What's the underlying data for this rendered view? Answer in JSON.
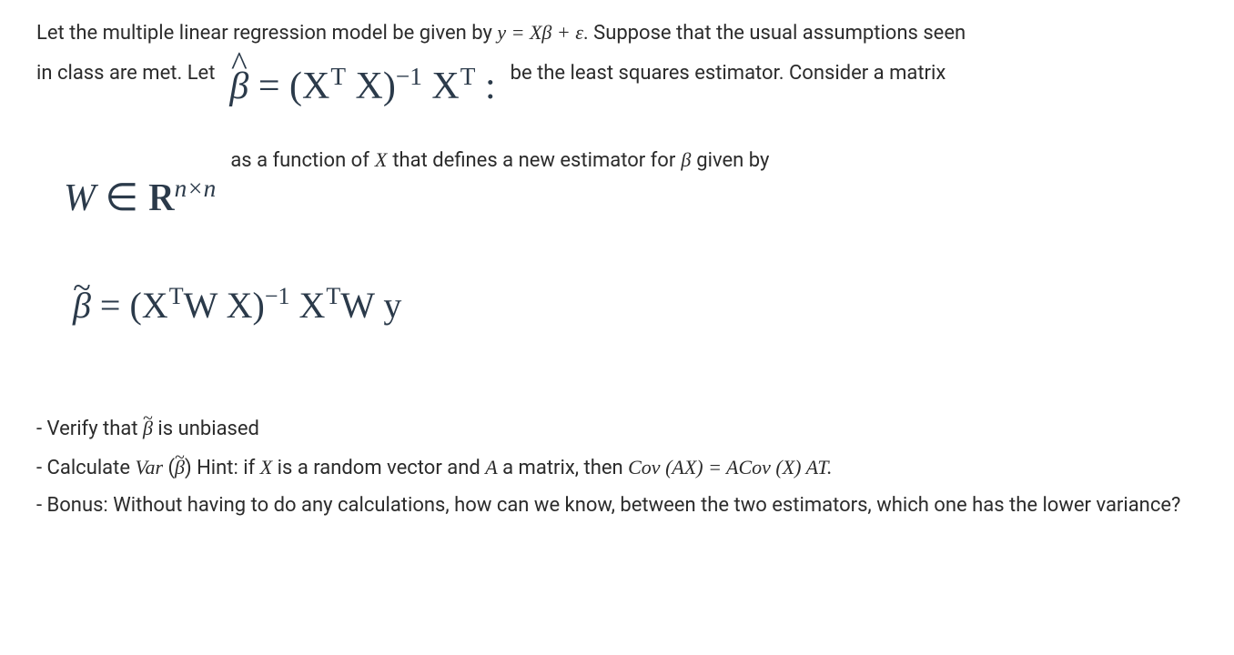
{
  "intro": {
    "line1_a": "Let the multiple linear regression model be given by ",
    "model_eq": "y = Xβ + ε",
    "line1_b": ". Suppose that the usual assumptions seen",
    "line2_a": "in class are met. Let",
    "line2_b": "be the least squares estimator. Consider a matrix",
    "line3_a": "as a function of ",
    "line3_var": "X",
    "line3_b": " that defines a new estimator for ",
    "line3_beta": "β",
    "line3_c": " given by"
  },
  "math": {
    "beta_hat_lhs": "β̂",
    "beta_hat_rhs_open": " = (X",
    "sup_T": "T",
    "close_X_inv": " X)",
    "sup_neg1": "−1",
    "Xt_end": " X",
    "W_in": "W ∈ ",
    "R_letter": "R",
    "R_sup": "n×n",
    "tilde_lhs": "β̃",
    "beta_tilde_eq": " = (X",
    "WX_close": "W X)",
    "XTWy": "W y"
  },
  "list": {
    "i1_a": "- Verify that ",
    "i1_beta": "β̃",
    "i1_b": " is unbiased",
    "i2_a": "- Calculate ",
    "i2_var": "Var",
    "i2_paren_open": " (",
    "i2_beta": "β̃",
    "i2_paren_close": ")",
    "i2_hint": " Hint: if ",
    "i2_X": "X",
    "i2_mid": " is a random vector and ",
    "i2_A": "A",
    "i2_mid2": " a matrix, then ",
    "i2_cov1": "Cov",
    "i2_cov1_arg": " (AX) = ACov (X) AT.",
    "i3": "- Bonus: Without having to do any calculations, how can we know, between the two estimators, which one has the lower variance?"
  }
}
